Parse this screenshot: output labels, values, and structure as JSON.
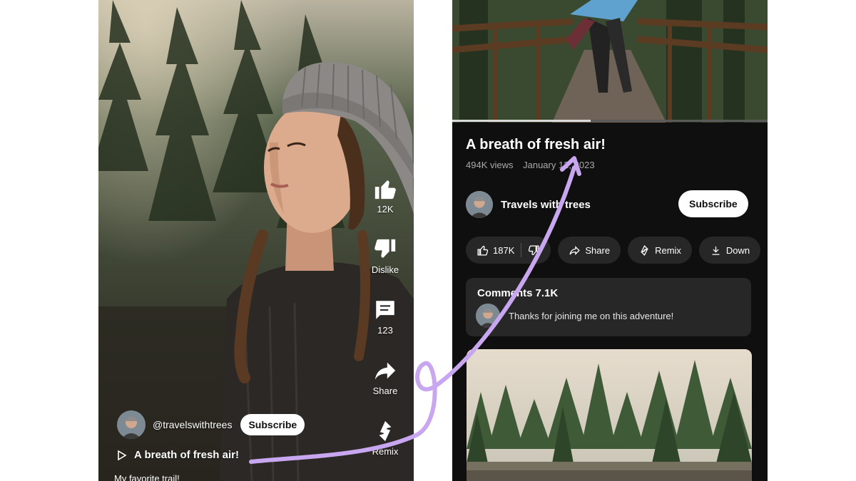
{
  "shorts": {
    "actions": [
      {
        "name": "like",
        "label": "12K",
        "icon": "thumbs-up-icon"
      },
      {
        "name": "dislike",
        "label": "Dislike",
        "icon": "thumbs-down-icon"
      },
      {
        "name": "comments",
        "label": "123",
        "icon": "comment-icon"
      },
      {
        "name": "share",
        "label": "Share",
        "icon": "share-icon"
      },
      {
        "name": "remix",
        "label": "Remix",
        "icon": "remix-icon"
      }
    ],
    "channel_handle": "@travelswithtrees",
    "subscribe_label": "Subscribe",
    "video_title": "A breath of fresh air!",
    "description": "My favorite trail!"
  },
  "watch": {
    "title": "A breath of fresh air!",
    "views": "494K views",
    "date": "January 12, 2023",
    "channel_name": "Travels with trees",
    "subscribe_label": "Subscribe",
    "chips": {
      "likes": "187K",
      "share": "Share",
      "remix": "Remix",
      "download": "Down"
    },
    "comments": {
      "label": "Comments",
      "count": "7.1K",
      "top_comment": "Thanks for joining me on this adventure!"
    }
  },
  "colors": {
    "arrow": "#c9a6f0",
    "dark_bg": "#0f0f0f",
    "chip_bg": "#272727"
  }
}
